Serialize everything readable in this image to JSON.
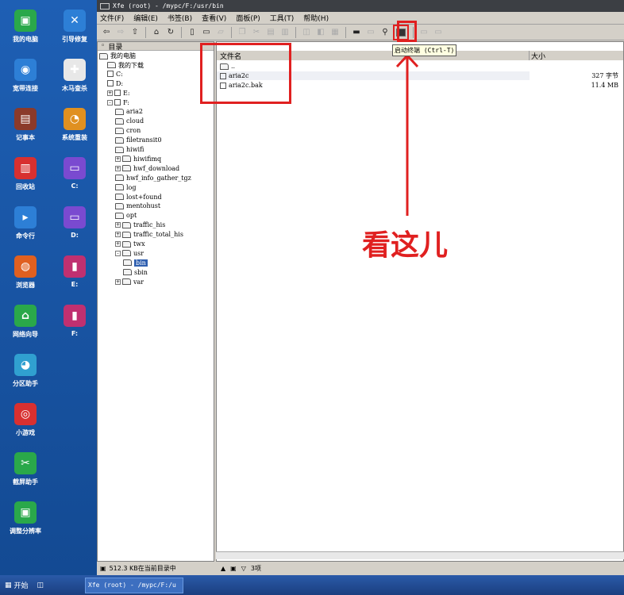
{
  "desktop": {
    "icons": [
      {
        "label": "我的电脑",
        "color": "#2aa84a",
        "glyph": "▣"
      },
      {
        "label": "引导修复",
        "color": "#2d7fd6",
        "glyph": "✕"
      },
      {
        "label": "宽带连接",
        "color": "#2d7fd6",
        "glyph": "◉"
      },
      {
        "label": "木马查杀",
        "color": "#e8e8e8",
        "glyph": "✚"
      },
      {
        "label": "记事本",
        "color": "#8b3a2a",
        "glyph": "▤"
      },
      {
        "label": "系统重装",
        "color": "#e09020",
        "glyph": "◔"
      },
      {
        "label": "回收站",
        "color": "#d83030",
        "glyph": "▥"
      },
      {
        "label": "C:",
        "color": "#7a4ad0",
        "glyph": "▭"
      },
      {
        "label": "命令行",
        "color": "#2d7fd6",
        "glyph": "▸"
      },
      {
        "label": "D:",
        "color": "#7a4ad0",
        "glyph": "▭"
      },
      {
        "label": "浏览器",
        "color": "#e06020",
        "glyph": "◍"
      },
      {
        "label": "E:",
        "color": "#c03070",
        "glyph": "▮"
      },
      {
        "label": "网络向导",
        "color": "#2aa84a",
        "glyph": "⌂"
      },
      {
        "label": "F:",
        "color": "#c03070",
        "glyph": "▮"
      },
      {
        "label": "分区助手",
        "color": "#30a0d0",
        "glyph": "◕"
      },
      {
        "label": "小游戏",
        "color": "#d83030",
        "glyph": "◎"
      },
      {
        "label": "截屏助手",
        "color": "#2aa84a",
        "glyph": "✂"
      },
      {
        "label": "调整分辨率",
        "color": "#2aa84a",
        "glyph": "▣"
      }
    ]
  },
  "window": {
    "title": "Xfe (root) - /mypc/F:/usr/bin"
  },
  "menu": [
    "文件(F)",
    "编辑(E)",
    "书签(B)",
    "查看(V)",
    "面板(P)",
    "工具(T)",
    "帮助(H)"
  ],
  "toolbar": {
    "tooltip": "启动终端 (Ctrl-T)"
  },
  "dirpanel": {
    "header": "目录"
  },
  "tree": [
    {
      "label": "我的电脑",
      "type": "pc"
    },
    {
      "label": "我的下载",
      "type": "folder"
    },
    {
      "label": "C:",
      "type": "drive"
    },
    {
      "label": "D:",
      "type": "drive"
    },
    {
      "label": "E:",
      "type": "drive"
    },
    {
      "label": "F:",
      "type": "drive"
    },
    {
      "label": "aria2",
      "type": "folder"
    },
    {
      "label": "cloud",
      "type": "folder"
    },
    {
      "label": "cron",
      "type": "folder"
    },
    {
      "label": "filetransit0",
      "type": "folder"
    },
    {
      "label": "hiwifi",
      "type": "folder"
    },
    {
      "label": "hiwifimq",
      "type": "folder"
    },
    {
      "label": "hwf_download",
      "type": "folder"
    },
    {
      "label": "hwf_info_gather_tgz",
      "type": "folder"
    },
    {
      "label": "log",
      "type": "folder"
    },
    {
      "label": "lost+found",
      "type": "folder"
    },
    {
      "label": "mentohust",
      "type": "folder"
    },
    {
      "label": "opt",
      "type": "folder"
    },
    {
      "label": "traffic_his",
      "type": "folder"
    },
    {
      "label": "traffic_total_his",
      "type": "folder"
    },
    {
      "label": "twx",
      "type": "folder"
    },
    {
      "label": "usr",
      "type": "folder"
    },
    {
      "label": "bin",
      "type": "folder"
    },
    {
      "label": "sbin",
      "type": "folder"
    },
    {
      "label": "var",
      "type": "folder"
    }
  ],
  "files": {
    "col_name": "文件名",
    "col_size": "大小",
    "rows": [
      {
        "name": "..",
        "size": ""
      },
      {
        "name": "aria2c",
        "size": "327 字节"
      },
      {
        "name": "aria2c.bak",
        "size": "11.4 MB"
      }
    ]
  },
  "status": {
    "left": "512.3 KB在当前目录中",
    "right": "3项"
  },
  "taskbar": {
    "start": "开始",
    "task": "Xfe (root) - /mypc/F:/u"
  },
  "annotation": {
    "text": "看这儿"
  }
}
